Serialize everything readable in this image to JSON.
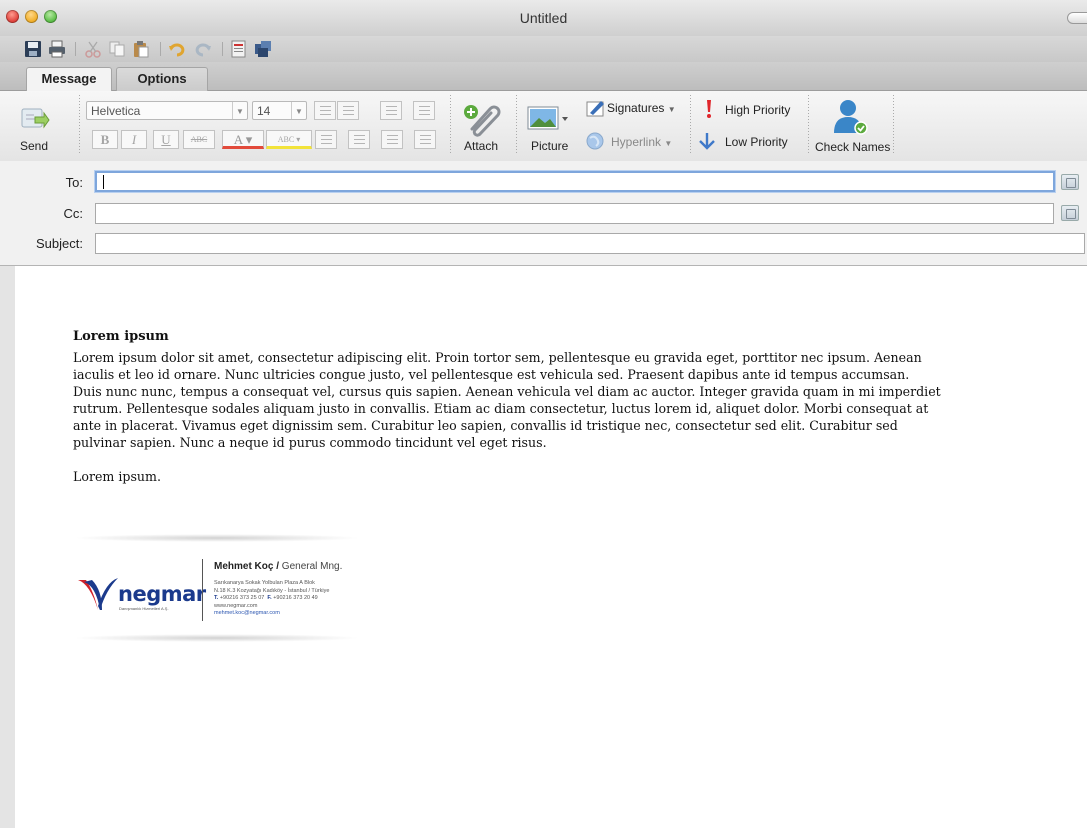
{
  "window": {
    "title": "Untitled"
  },
  "quick_toolbar": {
    "icons": [
      "save-icon",
      "print-icon",
      "cut-icon",
      "copy-icon",
      "paste-icon",
      "undo-icon",
      "redo-icon",
      "address-book-icon",
      "contacts-icon"
    ]
  },
  "tabs": [
    {
      "label": "Message",
      "active": true
    },
    {
      "label": "Options",
      "active": false
    }
  ],
  "ribbon": {
    "send_label": "Send",
    "font_name": "Helvetica",
    "font_size": "14",
    "bold": "B",
    "italic": "I",
    "underline": "U",
    "strike": "ABC",
    "font_color": "A",
    "highlight": "ABC",
    "attach_label": "Attach",
    "picture_label": "Picture",
    "signatures_label": "Signatures",
    "hyperlink_label": "Hyperlink",
    "high_priority_label": "High Priority",
    "low_priority_label": "Low Priority",
    "check_names_label": "Check Names"
  },
  "address": {
    "to_label": "To:",
    "to_value": "",
    "cc_label": "Cc:",
    "cc_value": "",
    "subject_label": "Subject:",
    "subject_value": ""
  },
  "message": {
    "heading": "Lorem ipsum",
    "paragraph": "Lorem ipsum dolor sit amet, consectetur adipiscing elit. Proin tortor sem, pellentesque eu gravida eget, porttitor nec ipsum. Aenean iaculis et leo id ornare. Nunc ultricies congue justo, vel pellentesque est vehicula sed. Praesent dapibus ante id tempus accumsan. Duis nunc nunc, tempus a consequat vel, cursus quis sapien. Aenean vehicula vel diam ac auctor. Integer gravida quam in mi imperdiet rutrum. Pellentesque sodales aliquam justo in convallis. Etiam ac diam consectetur, luctus lorem id, aliquet dolor. Morbi consequat at ante in placerat. Vivamus eget dignissim sem. Curabitur leo sapien, convallis id tristique nec, consectetur sed elit. Curabitur sed pulvinar sapien. Nunc a neque id purus commodo tincidunt vel eget risus.",
    "closing": "Lorem ipsum."
  },
  "signature": {
    "logo_text": "negmar",
    "logo_tagline": "Danışmanlık Hizmetleri A.Ş.",
    "name": "Mehmet Koç /",
    "title": "General Mng.",
    "address_line1": "Sarıkanarya Sokak Yolbulan Plaza A Blok",
    "address_line2": "N.18 K.3 Kozyatağı Kadıköy - İstanbul / Türkiye",
    "phone_prefix": "T.",
    "phone": "+90216 373 25 07",
    "fax_prefix": "F.",
    "fax": "+90216 373 20 49",
    "website": "www.negmar.com",
    "email": "mehmet.koc@negmar.com"
  },
  "colors": {
    "brand_blue": "#1b3a8c",
    "brand_red": "#d2232a",
    "focus_ring": "#7ea6dc"
  }
}
